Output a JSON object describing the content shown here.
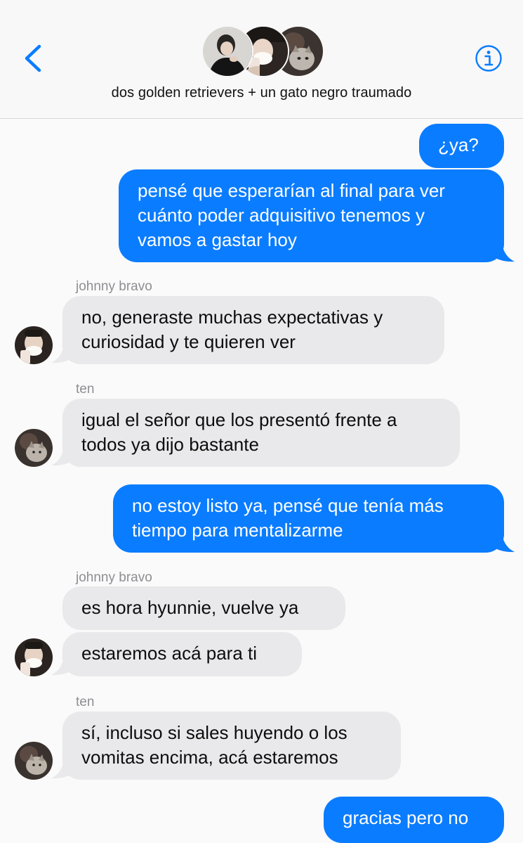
{
  "header": {
    "title": "dos golden retrievers + un gato negro traumado",
    "back_icon": "chevron-left-icon",
    "info_icon": "info-icon",
    "accent_color": "#0a7cff"
  },
  "senders": {
    "johnny": "johnny bravo",
    "ten": "ten"
  },
  "messages": [
    {
      "from": "me",
      "text": "¿ya?"
    },
    {
      "from": "me",
      "lines": [
        "pensé que esperarían al final para ver",
        "cuánto poder adquisitivo tenemos y",
        "vamos a gastar hoy"
      ]
    },
    {
      "from": "johnny bravo",
      "lines": [
        "no, generaste muchas expectativas y",
        "curiosidad y te quieren ver"
      ]
    },
    {
      "from": "ten",
      "lines": [
        "igual el señor que los presentó frente a",
        "todos ya dijo bastante"
      ]
    },
    {
      "from": "me",
      "lines": [
        "no estoy listo ya, pensé que tenía más",
        "tiempo para mentalizarme"
      ]
    },
    {
      "from": "johnny bravo",
      "text": "es hora hyunnie, vuelve ya"
    },
    {
      "from": "johnny bravo",
      "text": "estaremos acá para ti"
    },
    {
      "from": "ten",
      "lines": [
        "sí, incluso si sales huyendo o los",
        "vomitas encima, acá estaremos"
      ]
    },
    {
      "from": "me",
      "text": "gracias pero no"
    }
  ],
  "colors": {
    "outgoing_bubble": "#0a7cff",
    "incoming_bubble": "#e9e9eb",
    "sender_label": "#8e8e93"
  }
}
